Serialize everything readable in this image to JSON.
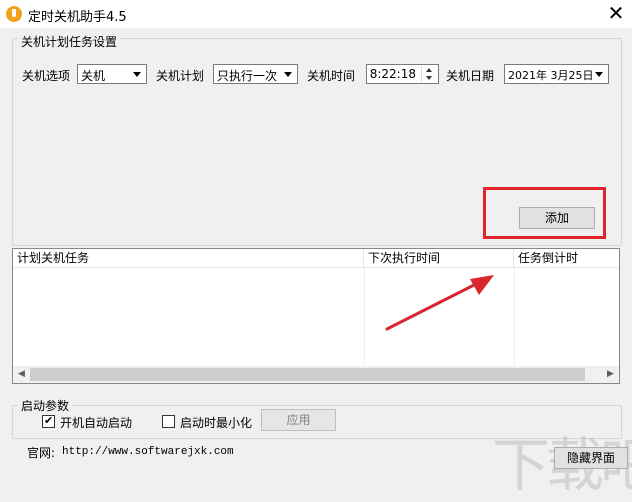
{
  "window": {
    "title": "定时关机助手4.5",
    "close_glyph": "✕"
  },
  "settings": {
    "group_title": "关机计划任务设置",
    "option_label": "关机选项",
    "option_value": "关机",
    "plan_label": "关机计划",
    "plan_value": "只执行一次",
    "time_label": "关机时间",
    "time_value": "8:22:18",
    "date_label": "关机日期",
    "date_value": "2021年 3月25日",
    "add_button": "添加"
  },
  "task_list": {
    "columns": [
      "计划关机任务",
      "下次执行时间",
      "任务倒计时"
    ],
    "rows": []
  },
  "startup": {
    "group_title": "启动参数",
    "autostart_label": "开机自动启动",
    "autostart_checked": true,
    "minimize_label": "启动时最小化",
    "minimize_checked": false,
    "apply_button": "应用"
  },
  "footer": {
    "site_label": "官网:",
    "site_url": "http://www.softwarejxk.com",
    "hide_button": "隐藏界面"
  },
  "colors": {
    "highlight": "#e0242a",
    "arrow": "#d9262c",
    "icon": "#f2a31b"
  }
}
